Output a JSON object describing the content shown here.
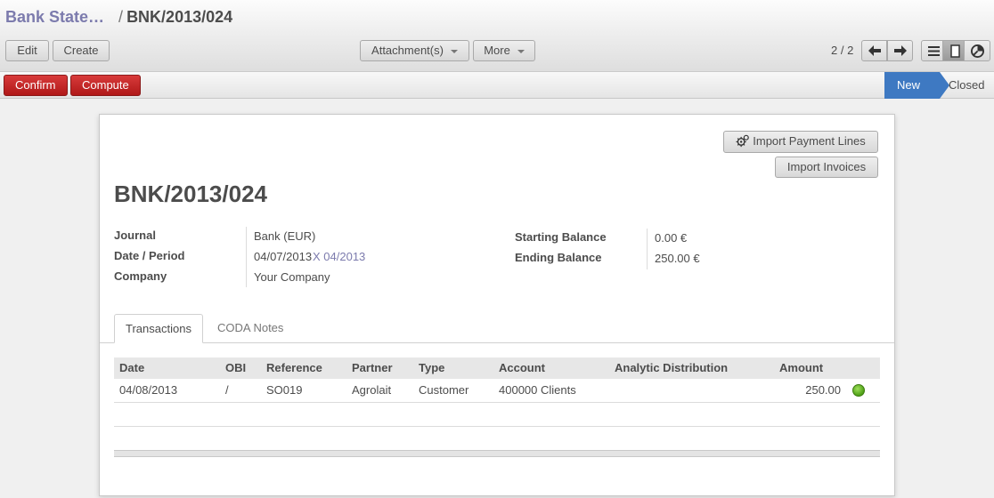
{
  "breadcrumb": {
    "parent": "Bank State…",
    "separator": "/",
    "current": "BNK/2013/024"
  },
  "toolbar": {
    "edit": "Edit",
    "create": "Create",
    "attachments": "Attachment(s)",
    "more": "More",
    "pager": "2 / 2"
  },
  "statusbar": {
    "confirm": "Confirm",
    "compute": "Compute",
    "stages": [
      "New",
      "Closed"
    ],
    "active_stage": "New"
  },
  "sheet": {
    "import_payment_lines": "Import Payment Lines",
    "import_invoices": "Import Invoices",
    "title": "BNK/2013/024",
    "fields": {
      "journal_label": "Journal",
      "journal_value": "Bank (EUR)",
      "date_period_label": "Date / Period",
      "date_value": "04/07/2013",
      "period_value": "X 04/2013",
      "company_label": "Company",
      "company_value": "Your Company",
      "starting_balance_label": "Starting Balance",
      "starting_balance_value": "0.00 €",
      "ending_balance_label": "Ending Balance",
      "ending_balance_value": "250.00 €"
    },
    "tabs": [
      "Transactions",
      "CODA Notes"
    ],
    "grid": {
      "columns": [
        "Date",
        "OBI",
        "Reference",
        "Partner",
        "Type",
        "Account",
        "Analytic Distribution",
        "Amount"
      ],
      "rows": [
        {
          "date": "04/08/2013",
          "obi": "/",
          "reference": "SO019",
          "partner": "Agrolait",
          "type": "Customer",
          "account": "400000 Clients",
          "analytic": "",
          "amount": "250.00"
        }
      ]
    }
  },
  "colors": {
    "accent": "#7c7bad",
    "stage_active": "#3e79c2",
    "action_red": "#c62828",
    "status_ok": "#5aa81f"
  }
}
